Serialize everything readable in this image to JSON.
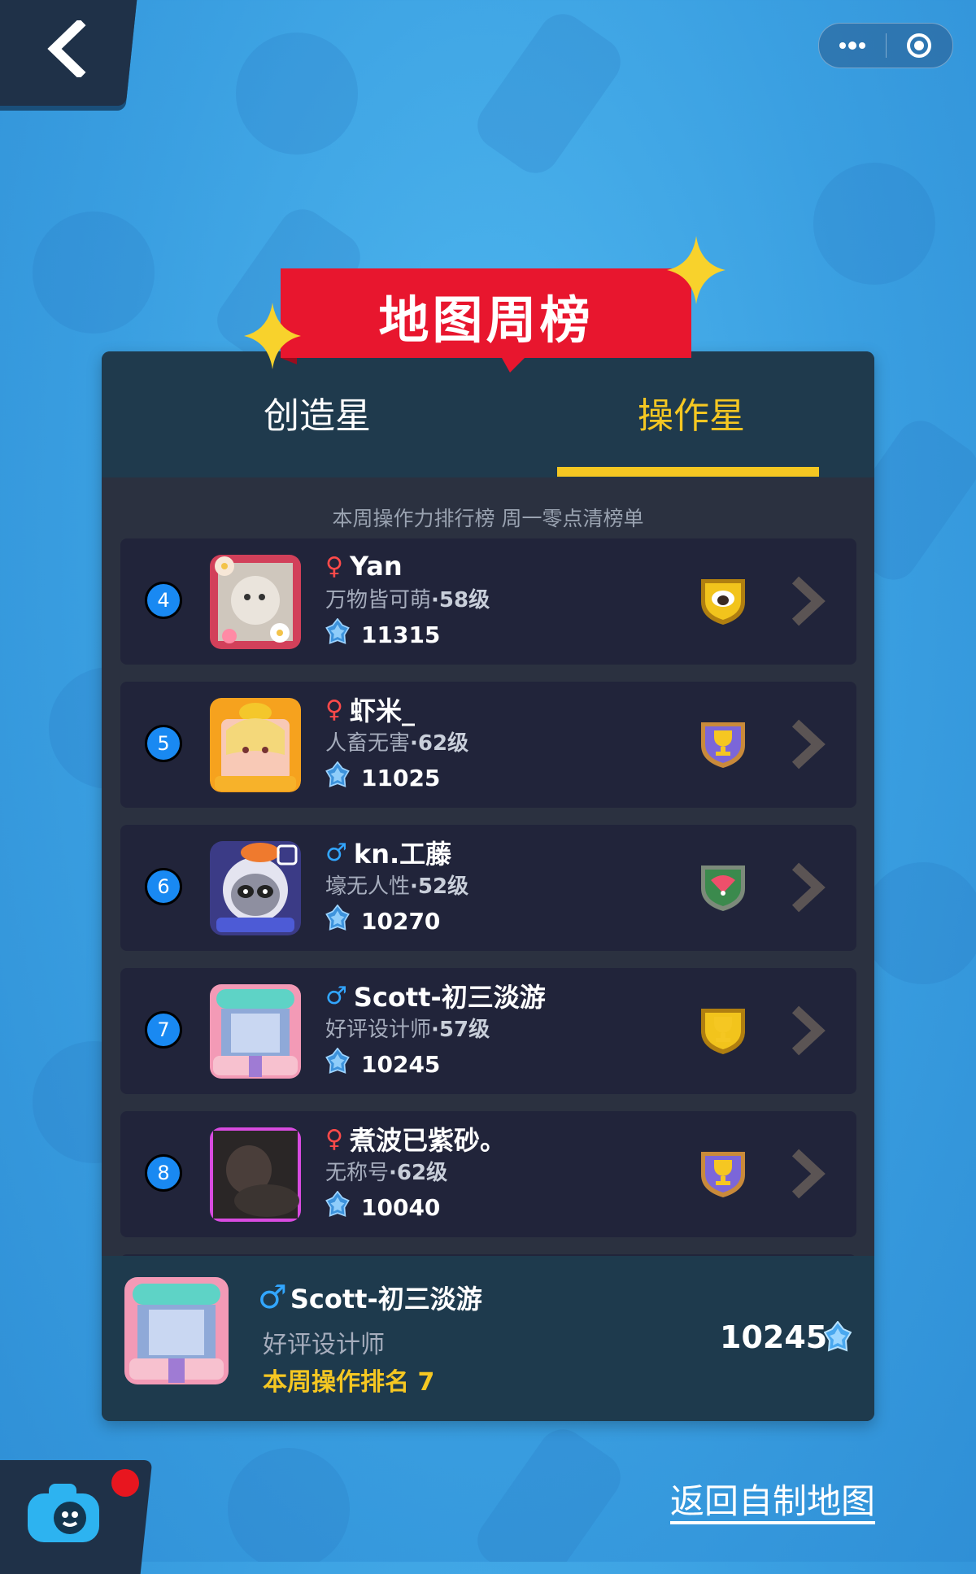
{
  "header": {
    "banner_title": "地图周榜",
    "tabs": [
      {
        "label": "创造星",
        "active": false
      },
      {
        "label": "操作星",
        "active": true
      }
    ],
    "subtitle": "本周操作力排行榜 周一零点清榜单"
  },
  "capsule": {
    "more_icon": "more-dots-icon",
    "close_icon": "target-icon"
  },
  "leaderboard": [
    {
      "rank": "4",
      "gender": "♀",
      "gender_type": "female",
      "name": "Yan",
      "title": "万物皆可萌",
      "level": "·58级",
      "score": "11315",
      "badge": "sheep-shield-badge",
      "badge_color": "#f2c41c"
    },
    {
      "rank": "5",
      "gender": "♀",
      "gender_type": "female",
      "name": "虾米_",
      "title": "人畜无害",
      "level": "·62级",
      "score": "11025",
      "badge": "trophy-shield-badge",
      "badge_color": "#7b66d9"
    },
    {
      "rank": "6",
      "gender": "♂",
      "gender_type": "male",
      "name": "kn.工藤",
      "title": "壕无人性",
      "level": "·52级",
      "score": "10270",
      "badge": "fan-shield-badge",
      "badge_color": "#3b8a4d"
    },
    {
      "rank": "7",
      "gender": "♂",
      "gender_type": "male",
      "name": "Scott-初三淡游",
      "title": "好评设计师",
      "level": "·57级",
      "score": "10245",
      "badge": "trophy-shield-badge",
      "badge_color": "#f2c41c"
    },
    {
      "rank": "8",
      "gender": "♀",
      "gender_type": "female",
      "name": "煮波已紫砂。",
      "title": "无称号",
      "level": "·62级",
      "score": "10040",
      "badge": "trophy-shield-badge",
      "badge_color": "#7b66d9"
    }
  ],
  "me": {
    "gender": "♂",
    "name": "Scott-初三淡游",
    "title": "好评设计师",
    "rank_text": "本周操作排名 7",
    "score": "10245"
  },
  "footer_link": "返回自制地图",
  "colors": {
    "accent_yellow": "#f5c722",
    "banner_red": "#e8162e",
    "rank_blue": "#1989f2"
  }
}
